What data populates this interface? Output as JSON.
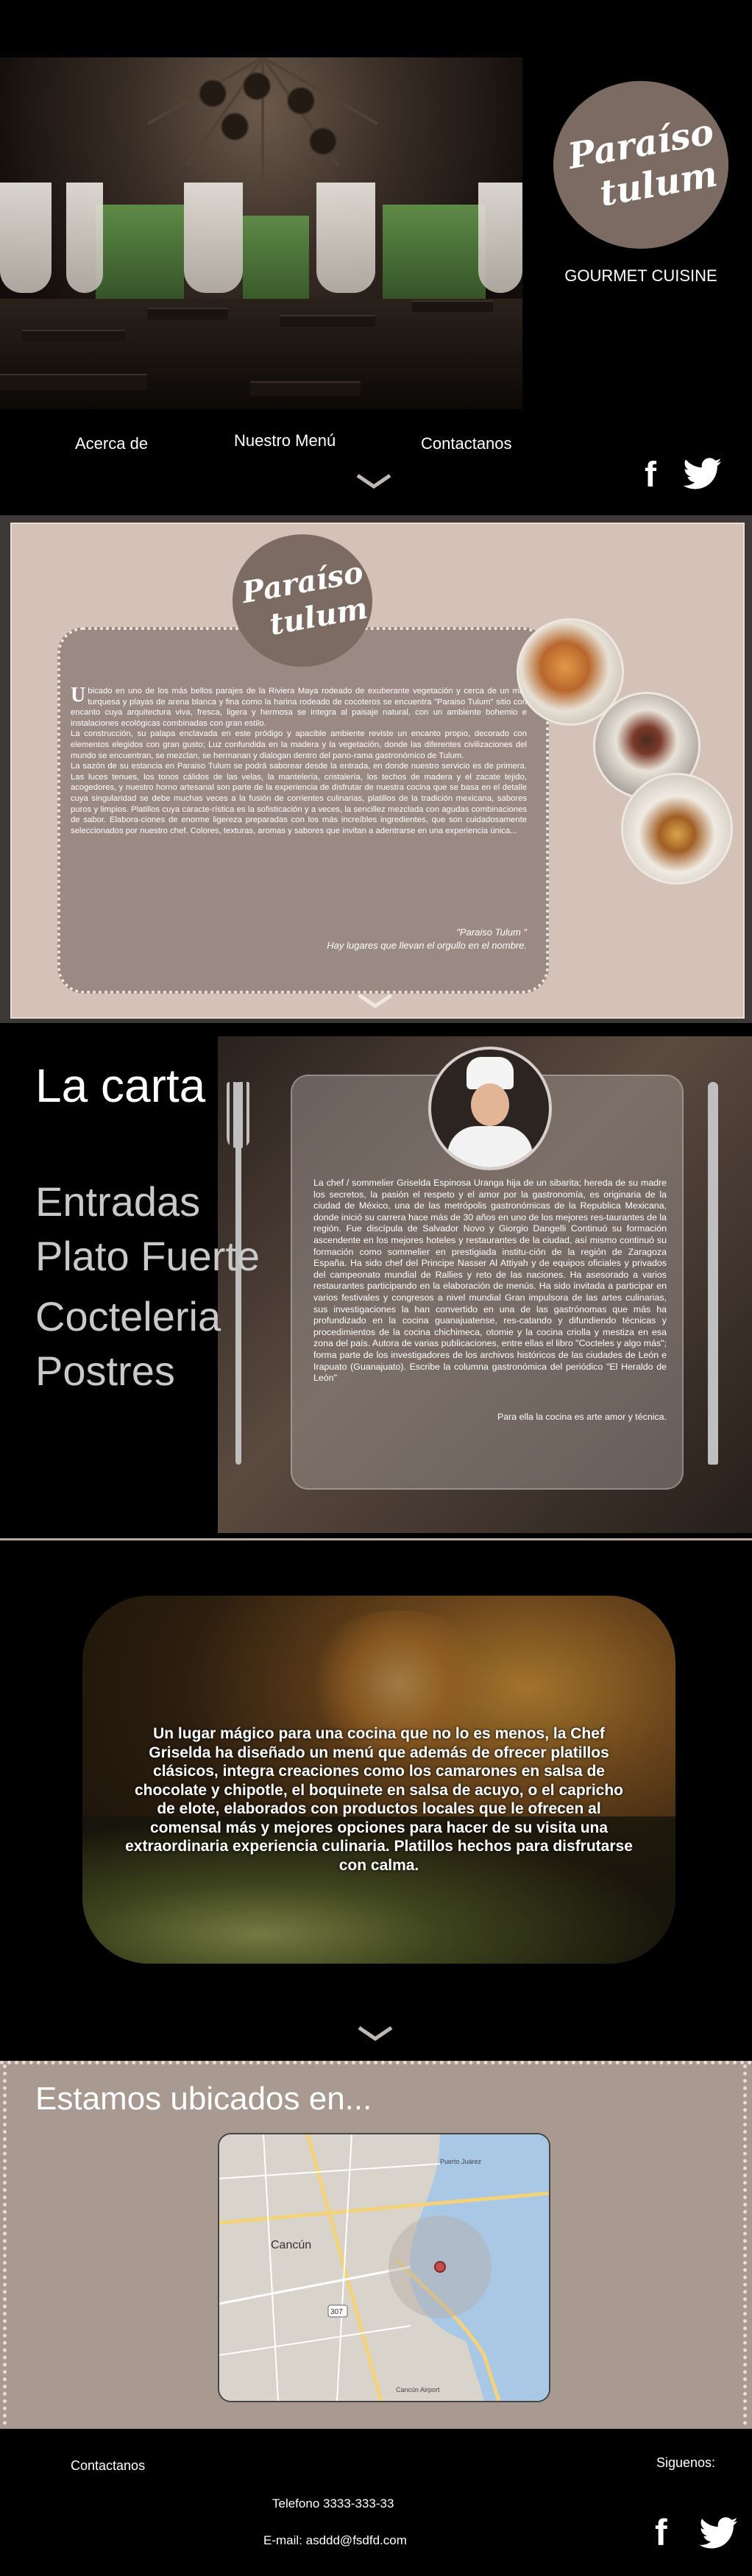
{
  "brand": {
    "logo_line1": "Paraíso",
    "logo_line2": "tulum",
    "tagline": "GOURMET CUISINE"
  },
  "nav": {
    "items": [
      {
        "label": "Acerca de"
      },
      {
        "label": "Nuestro Menú"
      },
      {
        "label": "Contactanos"
      }
    ]
  },
  "social": {
    "facebook_glyph": "f"
  },
  "about": {
    "dropcap": "U",
    "paragraph1": "bicado en uno de los más bellos parajes de la Riviera Maya rodeado de exuberante vegetación y cerca de un mar turquesa y playas de arena blanca y fina como la harina rodeado de cocoteros se encuentra \"Paraiso Tulum\" sitio con encanto cuya arquitectura viva, fresca, ligera y hermosa se integra al paisaje natural, con un ambiente bohemio e instalaciones ecológicas combinadas con gran estilo.",
    "paragraph2": "La construcción, su palapa enclavada en este pródigo y apacible ambiente reviste un encanto propio, decorado con elementos elegidos con gran gusto; Luz confundida en la madera y la vegetación, donde las diferentes civilizaciones del mundo se encuentran, se mezclan, se hermanan y dialogan dentro del pano-rama gastronómico de Tulum.",
    "paragraph3": "La sazón de su estancia en Paraiso Tulum se podrá saborear desde la entrada, en donde nuestro servicio es de primera. Las luces tenues, los tonos cálidos de las velas, la mantelería, cristalería, los techos de madera y el zacate tejido, acogedores, y nuestro horno artesanal son parte de la experiencia de disfrutar de nuestra cocina que se basa en el detalle cuya singularidad se debe muchas veces a la fusión de corrientes culinarias, platillos de la tradición mexicana, sabores puros y limpios. Platillos cuya caracte-rística es la sofisticación y a veces, la sencillez mezclada con agudas combinaciones de sabor. Elabora-ciones de enorme ligereza preparadas con los más increíbles ingredientes, que son cuidadosamente seleccionados por nuestro chef. Colores, texturas, aromas y sabores que invitan a adentrarse en una experiencia única...",
    "sign_name": "\"Paraiso Tulum \"",
    "sign_line": "Hay lugares que llevan el orgullo en el nombre."
  },
  "carta": {
    "title": "La carta",
    "menu": [
      {
        "label": "Entradas"
      },
      {
        "label": "Plato Fuerte"
      },
      {
        "label": "Cocteleria"
      },
      {
        "label": "Postres"
      }
    ],
    "bio": "La chef / sommelier  Griselda Espinosa Uranga hija de un sibarita; hereda de su madre los secretos, la pasión el respeto y el amor por la gastronomía, es originaria de la ciudad de México, una de las metrópolis gastronómicas de la Republica Mexicana, donde inició su carrera hace más de 30 años en uno de los mejores res-taurantes de la región. Fue discípula de Salvador Novo y Giorgio Dangelli Continuó su formación ascendente en los mejores hoteles y restaurantes de la ciudad, así mismo continuó su formación como sommelier en prestigiada institu-ción de la región de Zaragoza España. Ha sido chef del Principe Nasser Al Attiyah y de equipos oficiales y privados del campeonato mundial de Rallies y reto de las naciones. Ha asesorado a varios restaurantes participando en la elaboración de menús. Ha sido invitada a participar en varios festivales y congresos a nivel mundial Gran impulsora de las artes culinarias, sus investigaciones la han convertido en una de las gastrónomas que más ha profundizado en la cocina guanajuatense, res-catando y difundiendo técnicas y procedimientos de la cocina chichimeca, otomie y la cocina criolla y mestiza en esa zona del país. Autora de varias publicaciones, entre ellas el libro \"Cocteles y algo más\"; forma parte de los investigadores de los archivos históricos de las ciudades de León e Irapuato (Guanajuato). Escribe la columna gastronómica del periódico \"El Heraldo de León\"",
    "bio_last": "Para ella la cocina es arte amor y técnica."
  },
  "feature": {
    "text": "Un lugar mágico para una cocina que no lo es menos, la Chef Griselda ha diseñado un menú que además de ofrecer platillos clásicos, integra creaciones como los camarones en salsa de chocolate y chipotle,  el boquinete en salsa de acuyo, o el capricho de elote, elaborados  con productos locales que le ofrecen al comensal más y mejores opciones para hacer de su visita una extraordinaria experiencia culinaria. Platillos hechos para disfrutarse con calma."
  },
  "location": {
    "title": "Estamos ubicados en...",
    "map_city": "Cancún",
    "map_label_top": "Puerto Juárez",
    "map_label_bottom": "Cancún Airport",
    "map_route": "307"
  },
  "footer": {
    "contact_title": "Contactanos",
    "follow_title": "Siguenos:",
    "phone": "Telefono 3333-333-33",
    "email": "E-mail: asddd@fsdfd.com"
  },
  "colors": {
    "brand_brown": "#7b6b62",
    "panel_beige": "#d4c1b7",
    "location_bg": "#a89991"
  },
  "icons": [
    "chevron-down-icon",
    "facebook-icon",
    "twitter-icon",
    "map-pin-icon"
  ]
}
